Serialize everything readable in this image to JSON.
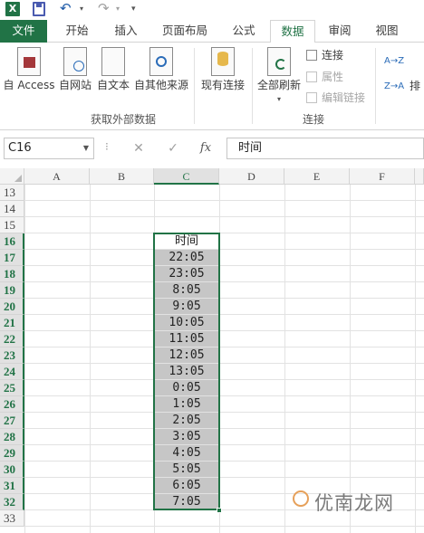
{
  "app": {
    "logo_letter": "X",
    "undo_glyph": "↶",
    "redo_glyph": "↷"
  },
  "tabs": [
    {
      "label": "文件",
      "kind": "file"
    },
    {
      "label": "开始"
    },
    {
      "label": "插入"
    },
    {
      "label": "页面布局"
    },
    {
      "label": "公式"
    },
    {
      "label": "数据",
      "active": true
    },
    {
      "label": "审阅"
    },
    {
      "label": "视图"
    }
  ],
  "ribbon": {
    "get_external": {
      "buttons": [
        "自 Access",
        "自网站",
        "自文本",
        "自其他来源",
        "现有连接"
      ],
      "group_label": "获取外部数据"
    },
    "connections": {
      "refresh_all": "全部刷新",
      "connect": "连接",
      "properties": "属性",
      "edit_links": "编辑链接",
      "group_label": "连接"
    },
    "sort": {
      "asc_icon": "A→Z",
      "desc_icon": "Z→A",
      "sort_label": "排"
    }
  },
  "formula_bar": {
    "name_box": "C16",
    "cancel": "✕",
    "enter": "✓",
    "fx": "fx",
    "value": "时间"
  },
  "columns": [
    "A",
    "B",
    "C",
    "D",
    "E",
    "F"
  ],
  "selected_column": "C",
  "rows": [
    "13",
    "14",
    "15",
    "16",
    "17",
    "18",
    "19",
    "20",
    "21",
    "22",
    "23",
    "24",
    "25",
    "26",
    "27",
    "28",
    "29",
    "30",
    "31",
    "32",
    "33"
  ],
  "column_c": {
    "16": "时间",
    "17": "22:05",
    "18": "23:05",
    "19": "8:05",
    "20": "9:05",
    "21": "10:05",
    "22": "11:05",
    "23": "12:05",
    "24": "13:05",
    "25": "0:05",
    "26": "1:05",
    "27": "2:05",
    "28": "3:05",
    "29": "4:05",
    "30": "5:05",
    "31": "6:05",
    "32": "7:05"
  },
  "watermark": "优南龙网",
  "colors": {
    "excel_green": "#217346",
    "data_fill": "#c6c6c6"
  }
}
